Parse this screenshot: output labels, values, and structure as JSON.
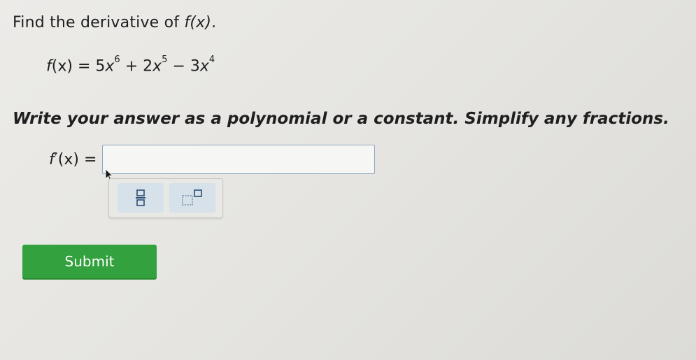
{
  "prompt": {
    "text": "Find the derivative of",
    "function_ref": "f(x)",
    "end": "."
  },
  "function_line": {
    "lhs": "f",
    "lhs_arg": "(x)",
    "equals": "=",
    "term1_coef": "5",
    "term1_var": "x",
    "term1_exp": "6",
    "op1": "+",
    "term2_coef": "2",
    "term2_var": "x",
    "term2_exp": "5",
    "op2": "−",
    "term3_coef": "3",
    "term3_var": "x",
    "term3_exp": "4"
  },
  "instructions": "Write your answer as a polynomial or a constant. Simplify any fractions.",
  "answer": {
    "label_f": "f",
    "label_prime": "′",
    "label_arg": "(x)",
    "label_equals": "=",
    "value": ""
  },
  "toolbar": {
    "buttons": [
      {
        "name": "fraction-button",
        "icon": "fraction-icon"
      },
      {
        "name": "exponent-button",
        "icon": "exponent-icon"
      }
    ]
  },
  "submit": {
    "label": "Submit"
  },
  "colors": {
    "submit_bg": "#33a13e",
    "tool_bg": "#d7e1ea",
    "input_border": "#8ea7bf"
  }
}
